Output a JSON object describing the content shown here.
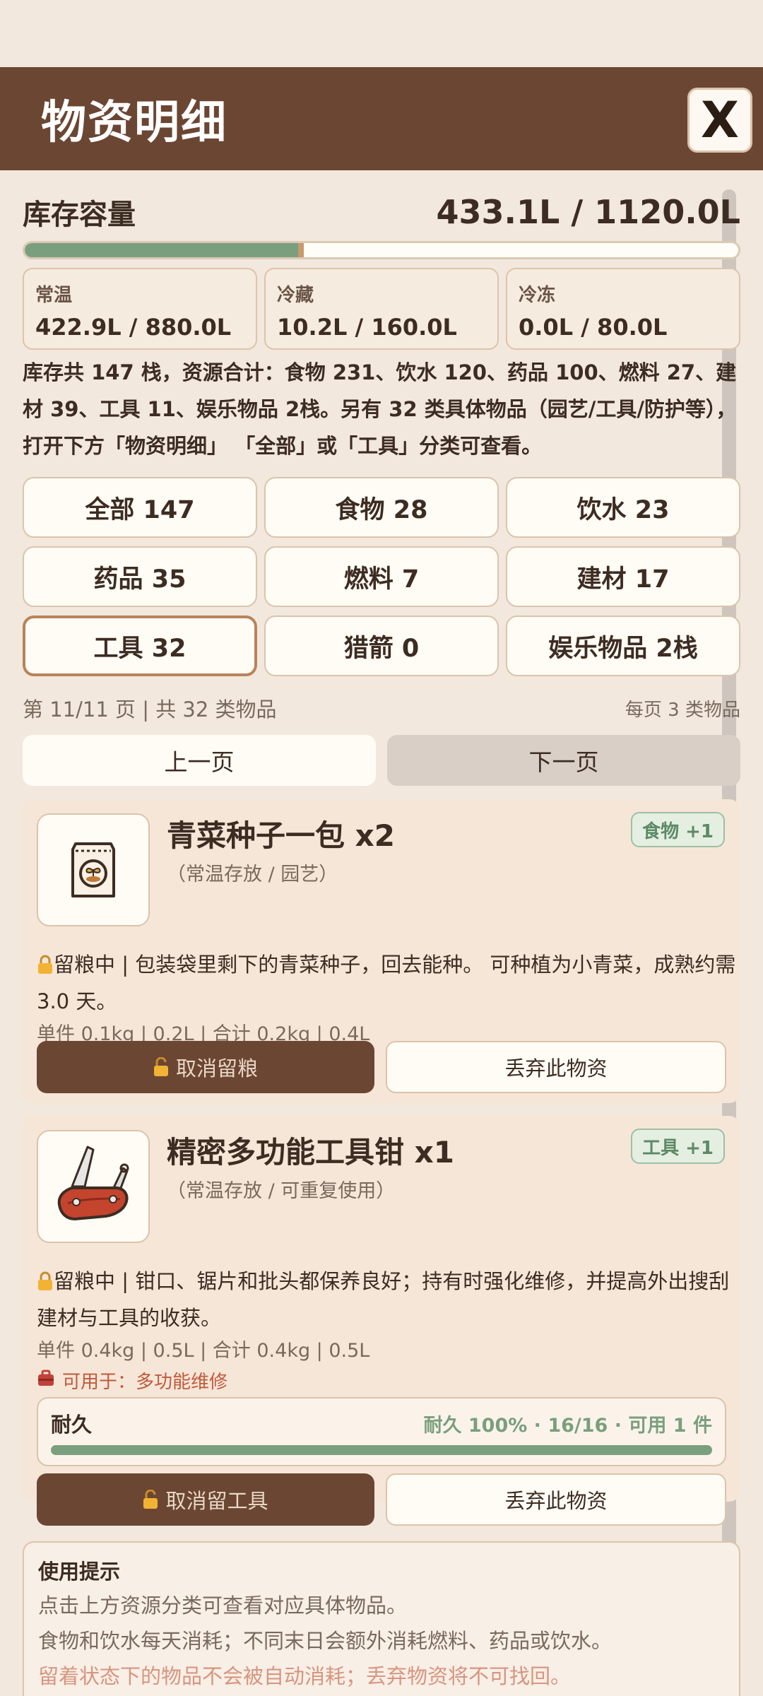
{
  "header": {
    "title": "物资明细",
    "close_label": "X"
  },
  "capacity": {
    "label": "库存容量",
    "value": "433.1L / 1120.0L",
    "used_fraction": 0.387
  },
  "zones": [
    {
      "label": "常温",
      "value": "422.9L / 880.0L"
    },
    {
      "label": "冷藏",
      "value": "10.2L / 160.0L"
    },
    {
      "label": "冷冻",
      "value": "0.0L / 80.0L"
    }
  ],
  "summary": "库存共 147 栈，资源合计：食物 231、饮水 120、药品 100、燃料 27、建材 39、工具 11、娱乐物品 2栈。另有 32 类具体物品（园艺/工具/防护等），打开下方「物资明细」 「全部」或「工具」分类可查看。",
  "categories": [
    {
      "label": "全部 147",
      "active": false
    },
    {
      "label": "食物 28",
      "active": false
    },
    {
      "label": "饮水 23",
      "active": false
    },
    {
      "label": "药品 35",
      "active": false
    },
    {
      "label": "燃料 7",
      "active": false
    },
    {
      "label": "建材 17",
      "active": false
    },
    {
      "label": "工具 32",
      "active": true
    },
    {
      "label": "猎箭 0",
      "active": false
    },
    {
      "label": "娱乐物品 2栈",
      "active": false
    }
  ],
  "pagination": {
    "info": "第 11/11 页 | 共 32 类物品",
    "per_page": "每页 3 类物品",
    "prev_label": "上一页",
    "next_label": "下一页"
  },
  "items": [
    {
      "name": "青菜种子一包 x2",
      "sub": "（常温存放 / 园艺）",
      "badge": "食物 +1",
      "icon": "seed-packet-icon",
      "desc": "留粮中 | 包装袋里剩下的青菜种子，回去能种。 可种植为小青菜，成熟约需 3.0 天。",
      "spec": "单件 0.1kg | 0.2L | 合计 0.2kg | 0.4L",
      "primary_label": "取消留粮",
      "secondary_label": "丢弃此物资"
    },
    {
      "name": "精密多功能工具钳 x1",
      "sub": "（常温存放 / 可重复使用）",
      "badge": "工具 +1",
      "icon": "multitool-icon",
      "desc": "留粮中 | 钳口、锯片和批头都保养良好；持有时强化维修，并提高外出搜刮建材与工具的收获。",
      "spec": "单件 0.4kg | 0.5L | 合计 0.4kg | 0.5L",
      "use": "可用于：多功能维修",
      "durability_label": "耐久",
      "durability_text": "耐久 100% · 16/16 · 可用 1 件",
      "durability_fraction": 1.0,
      "primary_label": "取消留工具",
      "secondary_label": "丢弃此物资"
    }
  ],
  "tips": {
    "title": "使用提示",
    "lines": [
      "点击上方资源分类可查看对应具体物品。",
      "食物和饮水每天消耗；不同末日会额外消耗燃料、药品或饮水。",
      "留着状态下的物品不会被自动消耗；丢弃物资将不可找回。"
    ]
  },
  "colors": {
    "header_bg": "#6b4633",
    "page_bg": "#f2e8dd",
    "accent_green": "#7a9f7e",
    "warn_red": "#c25a3c"
  }
}
